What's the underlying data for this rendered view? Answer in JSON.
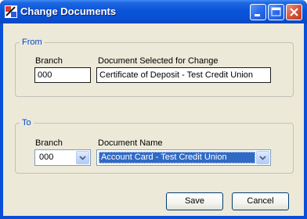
{
  "window": {
    "title": "Change Documents",
    "accent_color": "#0a4fd8",
    "titlebar_icons": [
      "minimize-icon",
      "maximize-icon",
      "close-icon"
    ]
  },
  "from_group": {
    "label": "From",
    "branch_label": "Branch",
    "branch_value": "000",
    "document_label": "Document Selected for Change",
    "document_value": "Certificate of Deposit - Test Credit Union"
  },
  "to_group": {
    "label": "To",
    "branch_label": "Branch",
    "branch_value": "000",
    "document_label": "Document Name",
    "document_value": "Account Card - Test Credit Union"
  },
  "buttons": {
    "save": "Save",
    "cancel": "Cancel"
  }
}
